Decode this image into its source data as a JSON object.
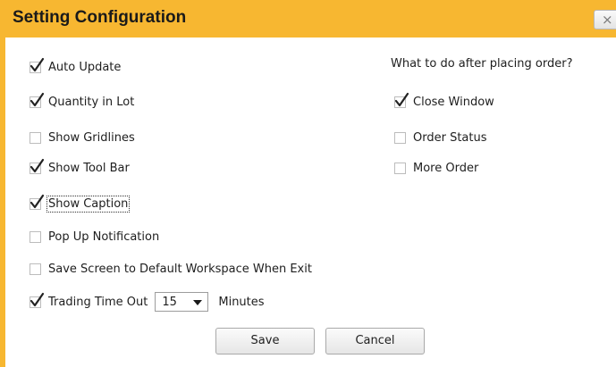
{
  "dialog": {
    "title": "Setting Configuration",
    "close_glyph": "×"
  },
  "left_options": [
    {
      "label": "Auto Update",
      "checked": true
    },
    {
      "label": "Quantity in Lot",
      "checked": true
    },
    {
      "label": "Show Gridlines",
      "checked": false
    },
    {
      "label": "Show Tool Bar",
      "checked": true
    },
    {
      "label": "Show Caption",
      "checked": true,
      "focused": true
    },
    {
      "label": "Pop Up Notification",
      "checked": false
    },
    {
      "label": "Save Screen to Default Workspace When Exit",
      "checked": false
    }
  ],
  "timeout": {
    "label": "Trading Time Out",
    "checked": true,
    "value": "15",
    "unit": "Minutes"
  },
  "after_order": {
    "question": "What to do after placing order?",
    "options": [
      {
        "label": "Close Window",
        "checked": true
      },
      {
        "label": "Order Status",
        "checked": false
      },
      {
        "label": "More Order",
        "checked": false
      }
    ]
  },
  "buttons": {
    "save_label": "Save",
    "cancel_label": "Cancel"
  },
  "colors": {
    "title_bar": "#f7b731",
    "check_mark": "#222222",
    "checkbox_border": "#bcbcbc"
  }
}
